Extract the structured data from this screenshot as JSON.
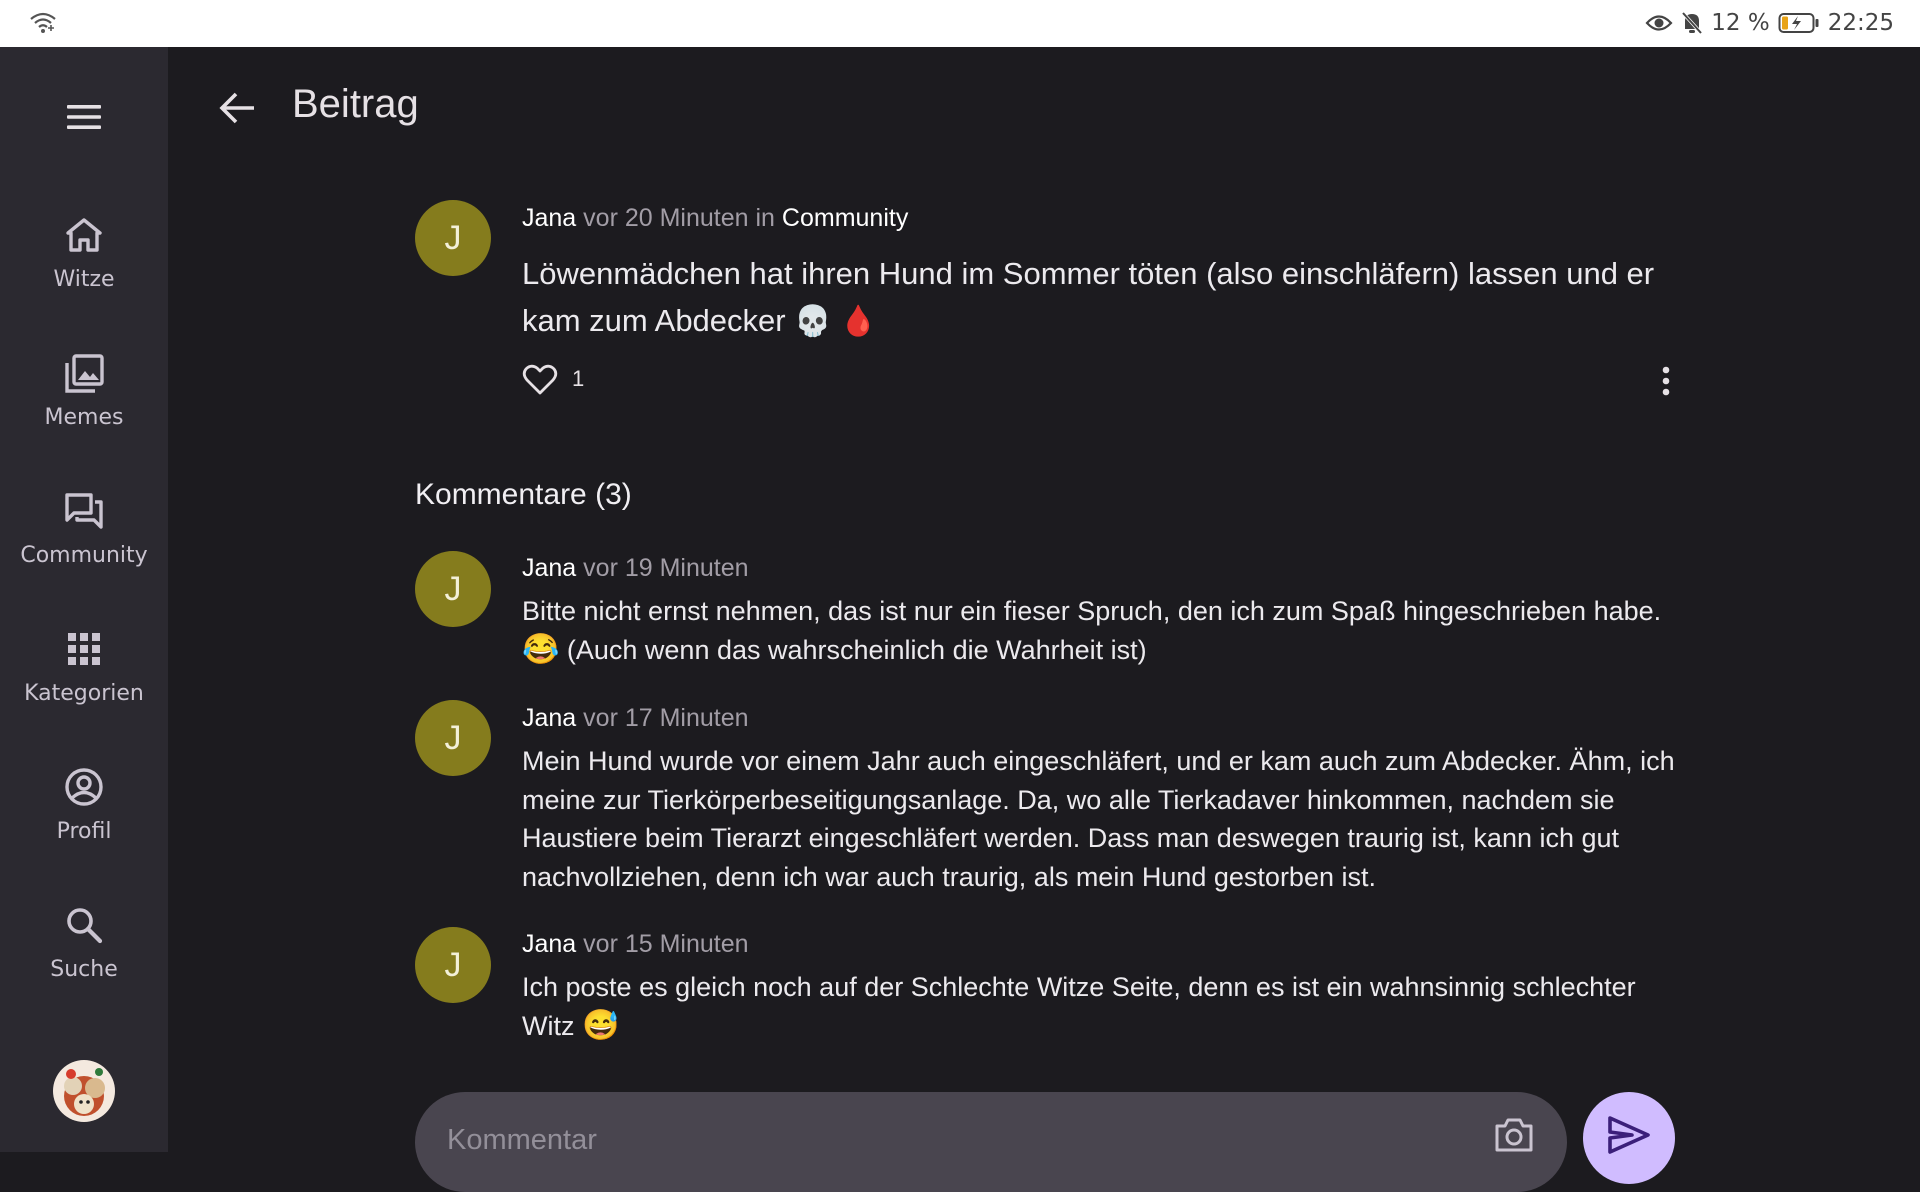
{
  "status_bar": {
    "battery": "12 %",
    "time": "22:25"
  },
  "nav": {
    "items": [
      {
        "label": "Witze",
        "icon": "home-icon"
      },
      {
        "label": "Memes",
        "icon": "gallery-icon"
      },
      {
        "label": "Community",
        "icon": "forum-icon"
      },
      {
        "label": "Kategorien",
        "icon": "grid-icon"
      },
      {
        "label": "Profil",
        "icon": "account-circle-icon"
      },
      {
        "label": "Suche",
        "icon": "search-icon"
      }
    ]
  },
  "header": {
    "title": "Beitrag"
  },
  "post": {
    "avatar_letter": "J",
    "author": "Jana",
    "time": "vor 20 Minuten",
    "in_word": "in",
    "community": "Community",
    "text": "Löwenmädchen hat ihren Hund im Sommer töten (also einschläfern) lassen und er kam zum Abdecker",
    "text_emojis": "💀 🩸",
    "likes": "1"
  },
  "comments_heading": "Kommentare (3)",
  "comments": [
    {
      "avatar_letter": "J",
      "author": "Jana",
      "time": "vor 19 Minuten",
      "text_before": "Bitte nicht ernst nehmen, das ist nur ein fieser Spruch, den ich zum Spaß hingeschrieben habe.",
      "emoji": "😂",
      "text_after": "(Auch wenn das wahrscheinlich die Wahrheit ist)"
    },
    {
      "avatar_letter": "J",
      "author": "Jana",
      "time": "vor 17 Minuten",
      "text": "Mein Hund wurde vor einem Jahr auch eingeschläfert, und er kam auch zum Abdecker. Ähm, ich meine zur Tierkörperbeseitigungsanlage. Da, wo alle Tierkadaver hinkommen, nachdem sie Haustiere beim Tierarzt eingeschläfert werden. Dass man deswegen traurig ist, kann ich gut nachvollziehen, denn ich war auch traurig, als mein Hund gestorben ist."
    },
    {
      "avatar_letter": "J",
      "author": "Jana",
      "time": "vor 15 Minuten",
      "text": "Ich poste es gleich noch auf der Schlechte Witze Seite, denn es ist ein wahnsinnig schlechter Witz",
      "emoji": "😅"
    }
  ],
  "comment_input": {
    "placeholder": "Kommentar",
    "value": ""
  },
  "colors": {
    "accent": "#d0bcff",
    "avatar": "#857c1d",
    "rail": "#2b2930",
    "background": "#1c1b1f"
  }
}
